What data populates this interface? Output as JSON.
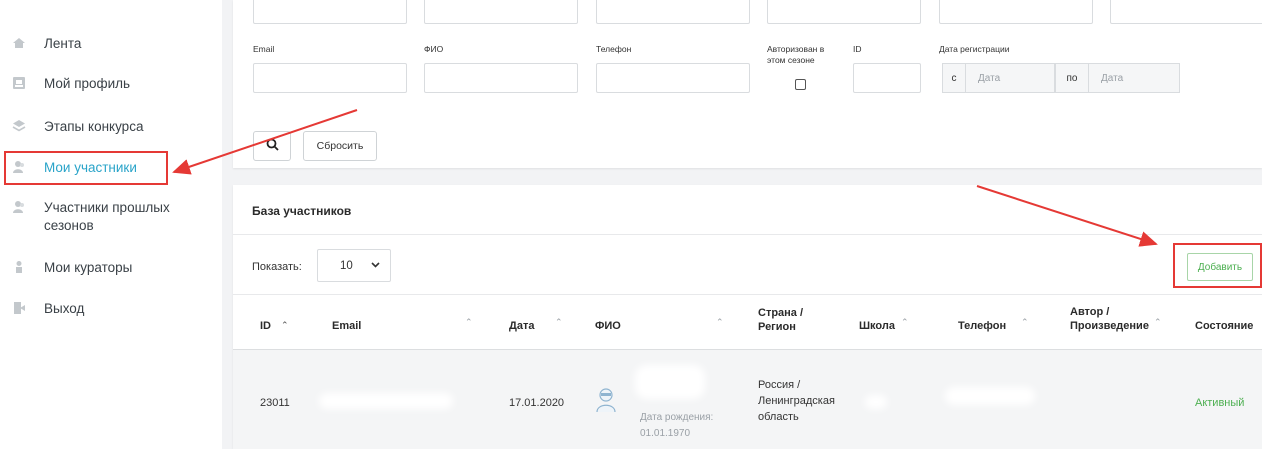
{
  "sidebar": {
    "items": [
      {
        "label": "Лента",
        "icon": "home-icon",
        "active": false
      },
      {
        "label": "Мой профиль",
        "icon": "profile-card-icon",
        "active": false
      },
      {
        "label": "Этапы конкурса",
        "icon": "layers-icon",
        "active": false
      },
      {
        "label": "Мои участники",
        "icon": "users-icon",
        "active": true
      },
      {
        "label": "Участники прошлых сезонов",
        "icon": "users-icon",
        "active": false
      },
      {
        "label": "Мои кураторы",
        "icon": "curator-icon",
        "active": false
      },
      {
        "label": "Выход",
        "icon": "exit-icon",
        "active": false
      }
    ]
  },
  "filters": {
    "email_label": "Email",
    "fio_label": "ФИО",
    "phone_label": "Телефон",
    "authorized_label": "Авторизован в этом сезоне",
    "id_label": "ID",
    "reg_date_label": "Дата регистрации",
    "date_from_addon": "с",
    "date_from_placeholder": "Дата",
    "date_to_addon": "по",
    "date_to_placeholder": "Дата",
    "reset_button": "Сбросить"
  },
  "base": {
    "title": "База участников",
    "show_label": "Показать:",
    "page_size": "10",
    "add_button": "Добавить",
    "columns": {
      "id": "ID",
      "email": "Email",
      "date": "Дата",
      "fio": "ФИО",
      "region": "Страна / Регион",
      "school": "Школа",
      "phone": "Телефон",
      "author": "Автор / Произведение",
      "status": "Состояние"
    },
    "rows": [
      {
        "id": "23011",
        "date": "17.01.2020",
        "birth_label": "Дата рождения:",
        "birth_date": "01.01.1970",
        "region": "Россия / Ленинградская область",
        "status": "Активный"
      }
    ]
  },
  "colors": {
    "accent": "#2aa4c9",
    "annotation": "#e53935",
    "status_active": "#4caf50"
  }
}
